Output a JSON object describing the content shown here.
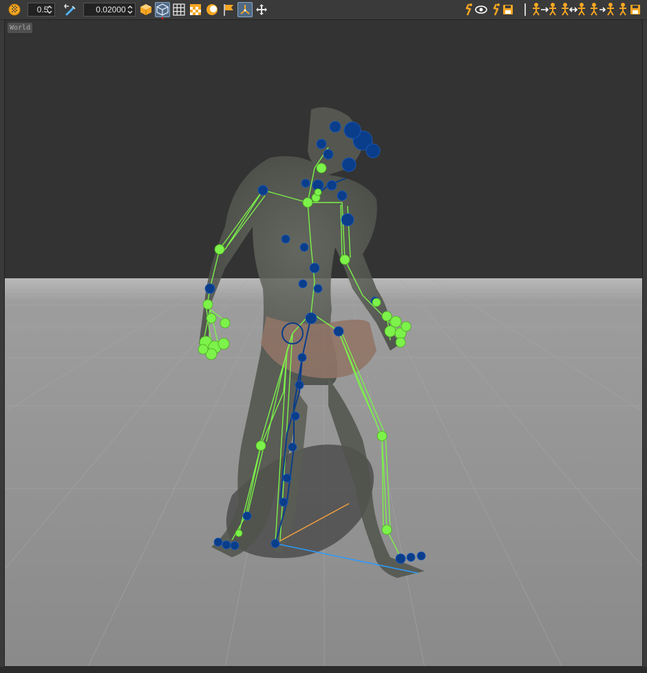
{
  "toolbar": {
    "opacity_value": "0.5",
    "bone_scale_value": "0.02000",
    "left_icons": [
      {
        "name": "opacity-icon"
      },
      {
        "name": "bone-scale-icon"
      },
      {
        "name": "shaded-mode-icon",
        "active": false
      },
      {
        "name": "wireframe-mode-icon",
        "active": true
      },
      {
        "name": "grid-icon",
        "active": false
      },
      {
        "name": "checker-icon",
        "active": false
      },
      {
        "name": "environment-icon",
        "active": false
      },
      {
        "name": "flag-icon",
        "active": false
      },
      {
        "name": "axis-gizmo-icon",
        "active": true
      },
      {
        "name": "move-gizmo-icon",
        "active": false
      }
    ],
    "right_icons": [
      {
        "name": "show-skeleton-icon"
      },
      {
        "name": "save-skeleton-icon"
      },
      {
        "name": "retarget-pose-icon"
      },
      {
        "name": "mirror-pose-icon"
      },
      {
        "name": "copy-pose-icon"
      },
      {
        "name": "save-pose-icon"
      }
    ],
    "accent_color": "#f4a623"
  },
  "viewport": {
    "space_label": "World",
    "background_color": "#333333",
    "floor_color": "#8c8c8c",
    "skeleton_bone_color": "#7cf24a",
    "joint_color": "#0a3d8a"
  }
}
